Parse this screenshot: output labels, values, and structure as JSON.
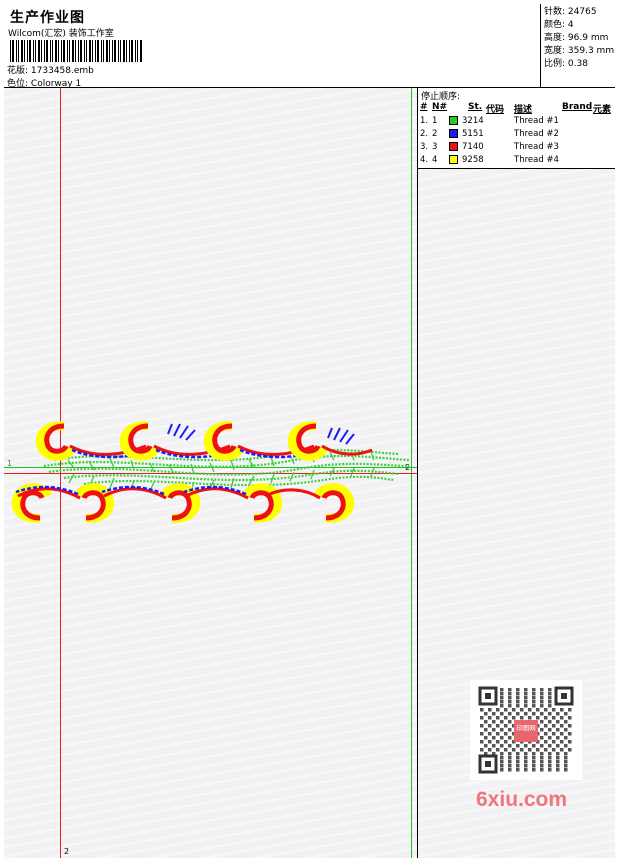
{
  "header": {
    "title": "生产作业图",
    "company": "Wilcom(汇宏) 装饰工作室",
    "design_file_label": "花版:",
    "design_file": "1733458.emb",
    "colorway_label": "色位:",
    "colorway": "Colorway 1"
  },
  "specs": {
    "stitches_label": "针数:",
    "stitches": "24765",
    "colors_label": "颜色:",
    "colors": "4",
    "height_label": "高度:",
    "height": "96.9 mm",
    "width_label": "宽度:",
    "width": "359.3 mm",
    "scale_label": "比例:",
    "scale": "0.38"
  },
  "stop_sequence": {
    "title": "停止顺序:",
    "columns": [
      "#",
      "N#",
      "St.",
      "代码",
      "描述",
      "Brand",
      "元素"
    ],
    "rows": [
      {
        "num": "1.",
        "needle": "1",
        "code": "3214",
        "color": "#22cc22",
        "desc": "Thread #1"
      },
      {
        "num": "2.",
        "needle": "2",
        "code": "5151",
        "color": "#1a1aff",
        "desc": "Thread #2"
      },
      {
        "num": "3.",
        "needle": "3",
        "code": "7140",
        "color": "#ee1111",
        "desc": "Thread #3"
      },
      {
        "num": "4.",
        "needle": "4",
        "code": "9258",
        "color": "#ffff00",
        "desc": "Thread #4"
      }
    ]
  },
  "guides": {
    "marker_1": "1",
    "marker_2": "2",
    "marker_2b": "2"
  },
  "watermark": "6xiu.com",
  "qr_badge": "印图网"
}
